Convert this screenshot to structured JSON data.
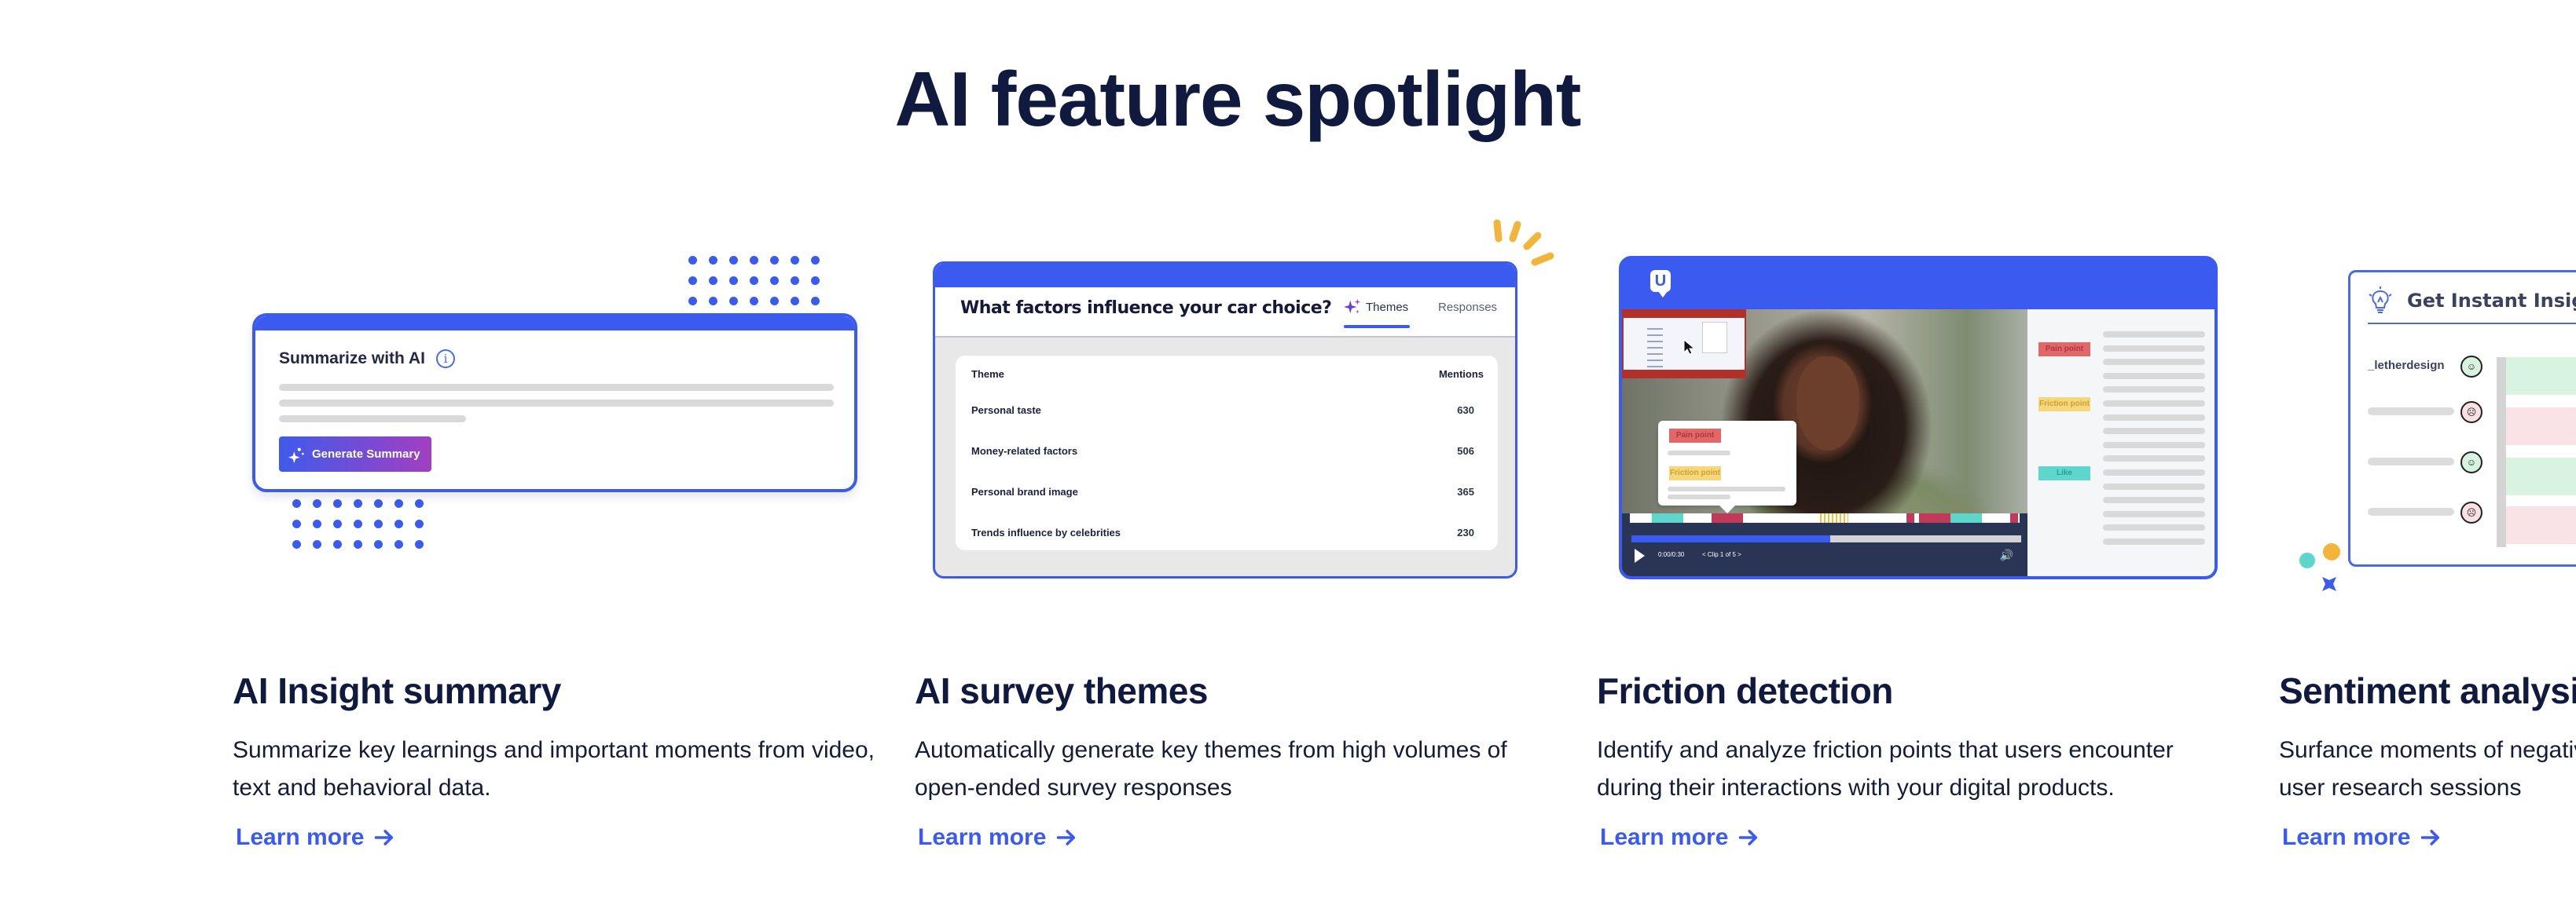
{
  "page": {
    "title": "AI feature spotlight"
  },
  "colors": {
    "brand_blue": "#3b5bf0",
    "heading": "#101a3f",
    "pain": "#e06868",
    "friction": "#f6d77b",
    "like": "#5fd6cc",
    "accent_yellow": "#f2b53a"
  },
  "features": [
    {
      "title": "AI Insight summary",
      "description": "Summarize key learnings and important moments from video, text and behavioral data.",
      "link_label": "Learn more",
      "link_icon": "arrow-right-icon",
      "illustration": {
        "heading": "Summarize with AI",
        "info_icon": "info-icon",
        "button_label": "Generate Summary",
        "button_icon": "sparkle-icon"
      }
    },
    {
      "title": "AI survey themes",
      "description": "Automatically generate key themes from high volumes of open-ended survey responses",
      "link_label": "Learn more",
      "link_icon": "arrow-right-icon",
      "illustration": {
        "question": "What factors influence your car choice?",
        "tabs": [
          {
            "label": "Themes",
            "icon": "sparkle-icon",
            "active": true
          },
          {
            "label": "Responses",
            "active": false
          }
        ],
        "table": {
          "columns": [
            "Theme",
            "Mentions"
          ],
          "rows": [
            {
              "theme": "Personal taste",
              "mentions": "630"
            },
            {
              "theme": "Money-related factors",
              "mentions": "506"
            },
            {
              "theme": "Personal brand image",
              "mentions": "365"
            },
            {
              "theme": "Trends influence by celebrities",
              "mentions": "230"
            }
          ]
        }
      }
    },
    {
      "title": "Friction detection",
      "description": "Identify and analyze friction points that users encounter during their interactions with your digital products.",
      "link_label": "Learn more",
      "link_icon": "arrow-right-icon",
      "illustration": {
        "logo": "U",
        "popup_tags": [
          "Pain point",
          "Friction point"
        ],
        "side_tags": [
          "Pain point",
          "Friction point",
          "Like"
        ],
        "time": "0:00/0:30",
        "clip": "< Clip 1 of 5 >",
        "progress": 0.51
      }
    },
    {
      "title": "Sentiment analysis",
      "description": "Surfance moments of negative and positive sentiment from user research sessions",
      "link_label": "Learn more",
      "link_icon": "arrow-right-icon",
      "illustration": {
        "heading": "Get Instant Insights",
        "heading_icon": "lightbulb-icon",
        "first_user": "_letherdesign",
        "rows": [
          "positive",
          "negative",
          "positive",
          "negative"
        ]
      }
    }
  ]
}
